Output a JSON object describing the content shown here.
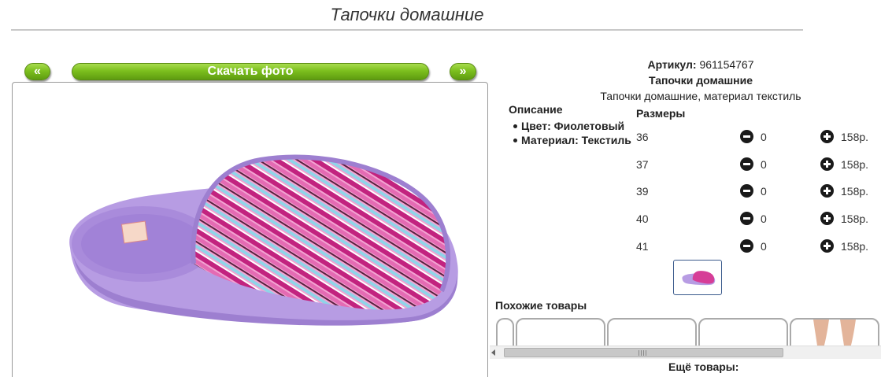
{
  "page": {
    "title": "Тапочки домашние"
  },
  "nav": {
    "prev_label": "«",
    "download_label": "Скачать фото",
    "next_label": "»"
  },
  "product": {
    "article_label": "Артикул:",
    "article_value": "961154767",
    "name": "Тапочки домашние",
    "short_description": "Тапочки домашние, материал текстиль"
  },
  "description": {
    "title": "Описание",
    "items": [
      {
        "label": "Цвет:",
        "value": "Фиолетовый"
      },
      {
        "label": "Материал:",
        "value": "Текстиль"
      }
    ]
  },
  "sizes": {
    "title": "Размеры",
    "rows": [
      {
        "size": "36",
        "qty": "0",
        "price": "158р."
      },
      {
        "size": "37",
        "qty": "0",
        "price": "158р."
      },
      {
        "size": "39",
        "qty": "0",
        "price": "158р."
      },
      {
        "size": "40",
        "qty": "0",
        "price": "158р."
      },
      {
        "size": "41",
        "qty": "0",
        "price": "158р."
      }
    ]
  },
  "similar": {
    "title": "Похожие товары"
  },
  "more": {
    "title": "Ещё товары:"
  },
  "colors": {
    "accent_green": "#7cbf1e",
    "slipper_purple": "#b79ce3",
    "slipper_pink": "#d63d97"
  }
}
